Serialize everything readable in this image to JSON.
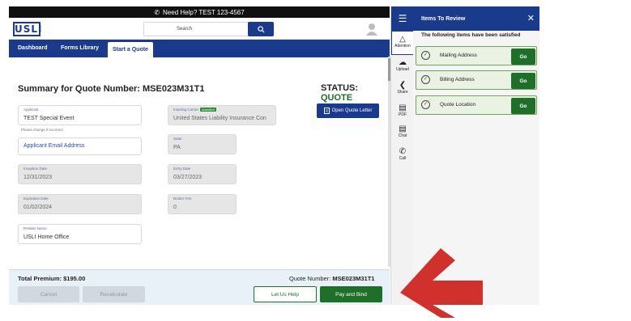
{
  "help_bar": {
    "text": "Need Help? TEST 123-4567",
    "icon": "phone-icon"
  },
  "header": {
    "logo": "USLI",
    "search_placeholder": "Search"
  },
  "nav": {
    "items": [
      "Dashboard",
      "Forms Library",
      "Start a Quote"
    ],
    "active": "Start a Quote"
  },
  "summary": {
    "title": "Summary for Quote Number: MSE023M31T1",
    "status_label": "STATUS:",
    "status_value": "QUOTE",
    "open_quote_letter": "Open Quote Letter"
  },
  "fields": {
    "applicant": {
      "label": "Applicant",
      "value": "TEST Special Event",
      "note": "Please change if incorrect"
    },
    "applicant_email": {
      "label": "Applicant Email Address"
    },
    "insuring_carrier": {
      "label": "Insuring Carrier",
      "badge": "Admitted",
      "value": "United States Liability Insurance Con"
    },
    "state": {
      "label": "State",
      "value": "PA"
    },
    "inception_date": {
      "label": "Inception Date",
      "value": "12/31/2023"
    },
    "entry_date": {
      "label": "Entry Date",
      "value": "03/27/2023"
    },
    "expiration_date": {
      "label": "Expiration Date",
      "value": "01/02/2024"
    },
    "broker_fee": {
      "label": "Broker Fee",
      "value": "0"
    },
    "retailer_name": {
      "label": "Retailer Name",
      "value": "USLI Home Office"
    }
  },
  "footer": {
    "total_premium_label": "Total Premium:",
    "total_premium_value": "$195.00",
    "quote_number_label": "Quote Number:",
    "quote_number_value": "MSE023M31T1",
    "cancel": "Cancel",
    "recalculate": "Recalculate",
    "let_us_help": "Let Us Help",
    "pay_and_bind": "Pay and Bind"
  },
  "rail": {
    "items": [
      "Attention",
      "Upload",
      "Share",
      "PDF",
      "Chat",
      "Call"
    ]
  },
  "review_panel": {
    "title": "Items To Review",
    "subtitle": "The following items have been satisfied",
    "items": [
      {
        "label": "Mailing Address",
        "action": "Go"
      },
      {
        "label": "Billing Address",
        "action": "Go"
      },
      {
        "label": "Quote Location",
        "action": "Go"
      }
    ]
  },
  "colors": {
    "brand_blue": "#1a3a8c",
    "action_green": "#1f6e2a",
    "arrow_red": "#d0312d"
  }
}
